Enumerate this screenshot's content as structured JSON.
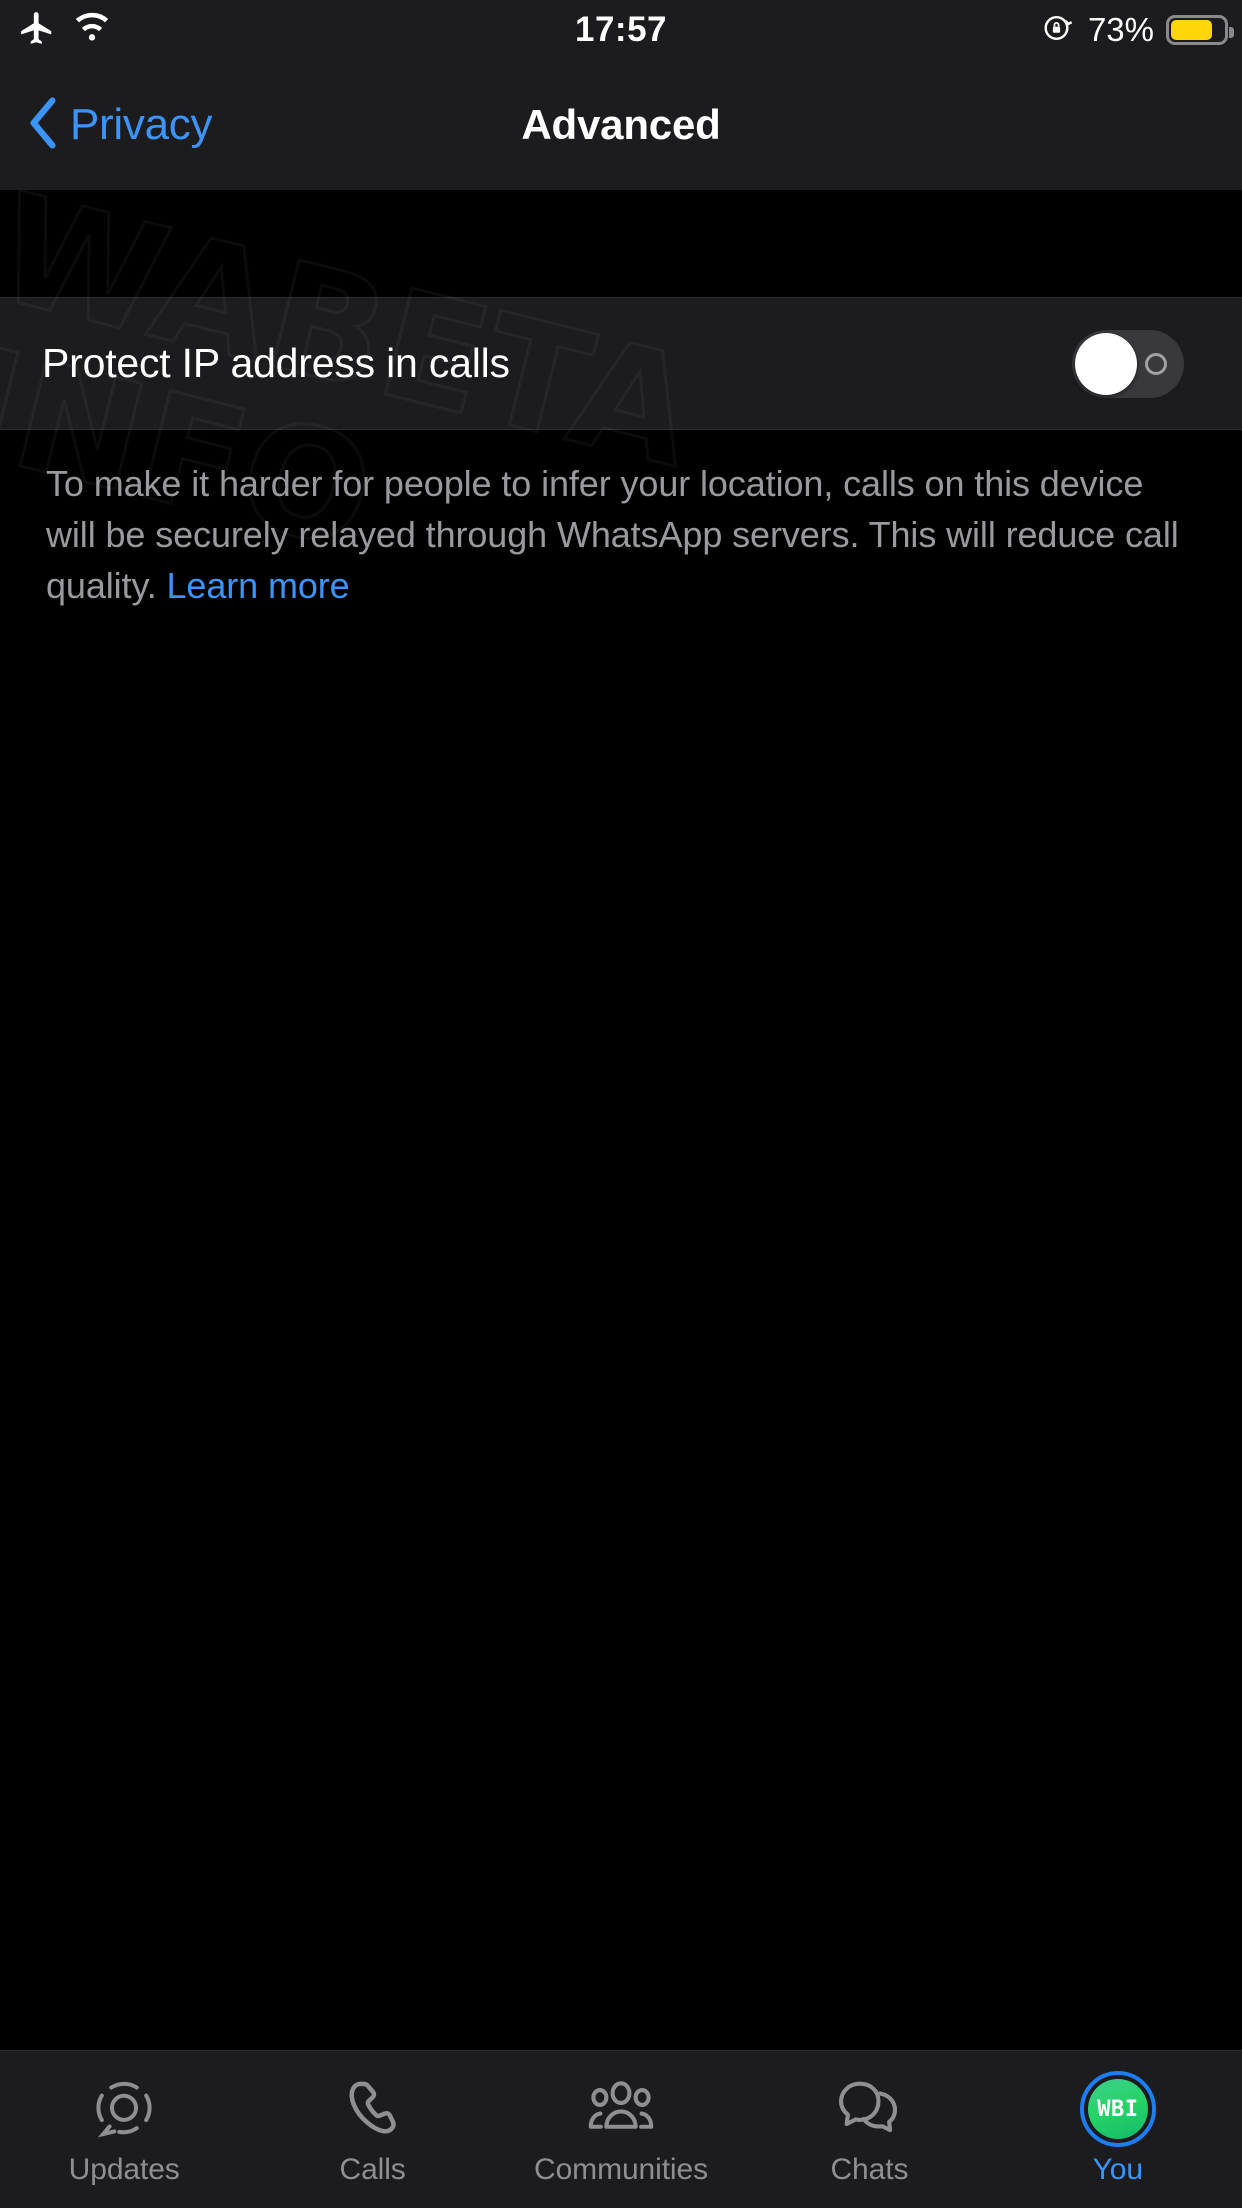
{
  "status_bar": {
    "airplane_icon": "airplane-icon",
    "wifi_icon": "wifi-icon",
    "time": "17:57",
    "rotation_lock_icon": "rotation-lock-icon",
    "battery_percent": "73%",
    "battery_level": 73,
    "battery_color": "#ffd60a"
  },
  "nav": {
    "back_label": "Privacy",
    "back_icon": "chevron-left-icon",
    "title": "Advanced",
    "accent_color": "#3b94f7"
  },
  "settings": {
    "row": {
      "label": "Protect IP address in calls",
      "toggle_state": "off",
      "toggle_off_mark": "o"
    },
    "footer_note": {
      "text": "To make it harder for people to infer your location, calls on this device will be securely relayed through WhatsApp servers. This will reduce call quality. ",
      "link_text": "Learn more"
    }
  },
  "watermark": {
    "line1": "WABETA",
    "line2": "INFO"
  },
  "tabbar": {
    "items": [
      {
        "label": "Updates",
        "icon": "updates-status-ring-icon",
        "active": false
      },
      {
        "label": "Calls",
        "icon": "phone-handset-icon",
        "active": false
      },
      {
        "label": "Communities",
        "icon": "communities-people-icon",
        "active": false
      },
      {
        "label": "Chats",
        "icon": "chat-bubbles-icon",
        "active": false
      },
      {
        "label": "You",
        "icon": "profile-avatar-icon",
        "active": true,
        "avatar_initials": "WBI",
        "avatar_color": "#25d366",
        "ring_color": "#1b7ef2"
      }
    ]
  }
}
